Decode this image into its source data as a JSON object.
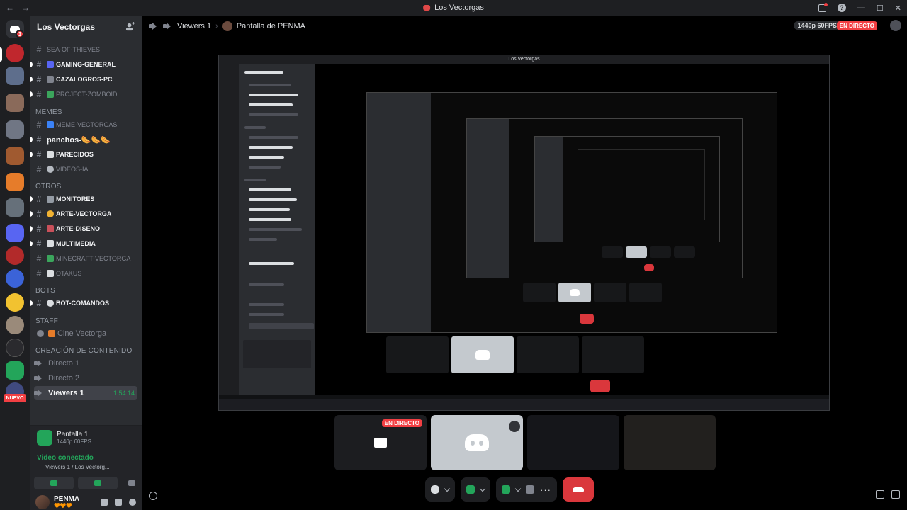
{
  "titlebar": {
    "title": "Los Vectorgas",
    "back": "←",
    "forward": "→",
    "minimize": "—",
    "maximize": "☐",
    "close": "✕"
  },
  "server": {
    "name": "Los Vectorgas",
    "home_badge": "3",
    "new_label": "NUEVO"
  },
  "channels": {
    "top": [
      "SEA-OF-THIEVES",
      "GAMING-GENERAL",
      "CAZALOGROS-PC",
      "PROJECT-ZOMBOID"
    ],
    "memes_category": "MEMES",
    "memes": [
      "MEME-VECTORGAS",
      "panchos-🌭🌭🌭",
      "PARECIDOS",
      "VIDEOS-IA"
    ],
    "otros_category": "OTROS",
    "otros": [
      "MONITORES",
      "ARTE-VECTORGA",
      "ARTE-DISENO",
      "MULTIMEDIA",
      "MINECRAFT-VECTORGA",
      "OTAKUS"
    ],
    "bots_category": "BOTS",
    "bots": [
      "BOT-COMANDOS"
    ],
    "staff_category": "STAFF",
    "staff": [
      "Cine Vectorga"
    ],
    "creacion_category": "CREACIÓN DE CONTENIDO",
    "voice": [
      "Directo 1",
      "Directo 2",
      "Viewers 1"
    ],
    "active_time": "1:54:14"
  },
  "stream_panel": {
    "title": "Pantalla 1",
    "sub": "1440p 60FPS",
    "status": "Video conectado",
    "location": "Viewers 1 / Los Vectorg..."
  },
  "user": {
    "name": "PENMA",
    "status": "🧡🧡🧡"
  },
  "header": {
    "channel": "Viewers 1",
    "separator": "›",
    "stream": "Pantalla de PENMA",
    "quality": "1440p 60FPS",
    "live": "EN DIRECTO"
  },
  "tiles": {
    "live_label": "EN DIRECTO"
  },
  "controls": {
    "more": "···"
  },
  "colors": {
    "accent": "#5865f2",
    "live": "#f23f43",
    "green": "#23a55a",
    "hangup": "#da373c"
  }
}
